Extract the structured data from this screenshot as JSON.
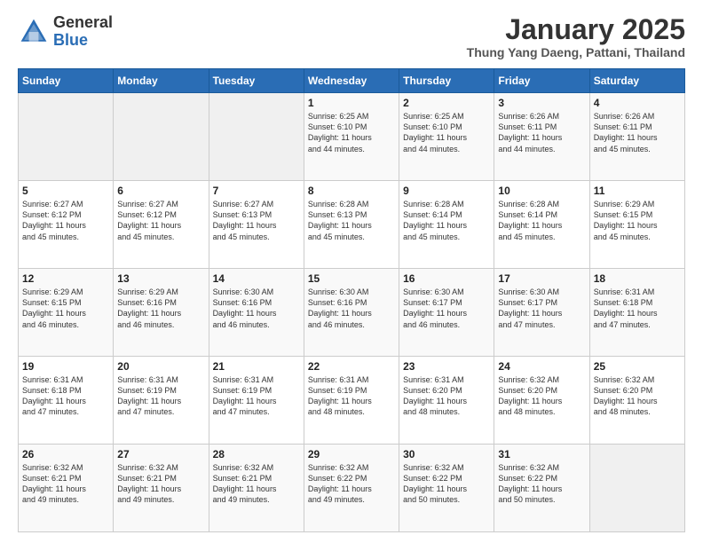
{
  "logo": {
    "general": "General",
    "blue": "Blue"
  },
  "title": "January 2025",
  "subtitle": "Thung Yang Daeng, Pattani, Thailand",
  "days_of_week": [
    "Sunday",
    "Monday",
    "Tuesday",
    "Wednesday",
    "Thursday",
    "Friday",
    "Saturday"
  ],
  "weeks": [
    [
      {
        "day": "",
        "info": ""
      },
      {
        "day": "",
        "info": ""
      },
      {
        "day": "",
        "info": ""
      },
      {
        "day": "1",
        "info": "Sunrise: 6:25 AM\nSunset: 6:10 PM\nDaylight: 11 hours\nand 44 minutes."
      },
      {
        "day": "2",
        "info": "Sunrise: 6:25 AM\nSunset: 6:10 PM\nDaylight: 11 hours\nand 44 minutes."
      },
      {
        "day": "3",
        "info": "Sunrise: 6:26 AM\nSunset: 6:11 PM\nDaylight: 11 hours\nand 44 minutes."
      },
      {
        "day": "4",
        "info": "Sunrise: 6:26 AM\nSunset: 6:11 PM\nDaylight: 11 hours\nand 45 minutes."
      }
    ],
    [
      {
        "day": "5",
        "info": "Sunrise: 6:27 AM\nSunset: 6:12 PM\nDaylight: 11 hours\nand 45 minutes."
      },
      {
        "day": "6",
        "info": "Sunrise: 6:27 AM\nSunset: 6:12 PM\nDaylight: 11 hours\nand 45 minutes."
      },
      {
        "day": "7",
        "info": "Sunrise: 6:27 AM\nSunset: 6:13 PM\nDaylight: 11 hours\nand 45 minutes."
      },
      {
        "day": "8",
        "info": "Sunrise: 6:28 AM\nSunset: 6:13 PM\nDaylight: 11 hours\nand 45 minutes."
      },
      {
        "day": "9",
        "info": "Sunrise: 6:28 AM\nSunset: 6:14 PM\nDaylight: 11 hours\nand 45 minutes."
      },
      {
        "day": "10",
        "info": "Sunrise: 6:28 AM\nSunset: 6:14 PM\nDaylight: 11 hours\nand 45 minutes."
      },
      {
        "day": "11",
        "info": "Sunrise: 6:29 AM\nSunset: 6:15 PM\nDaylight: 11 hours\nand 45 minutes."
      }
    ],
    [
      {
        "day": "12",
        "info": "Sunrise: 6:29 AM\nSunset: 6:15 PM\nDaylight: 11 hours\nand 46 minutes."
      },
      {
        "day": "13",
        "info": "Sunrise: 6:29 AM\nSunset: 6:16 PM\nDaylight: 11 hours\nand 46 minutes."
      },
      {
        "day": "14",
        "info": "Sunrise: 6:30 AM\nSunset: 6:16 PM\nDaylight: 11 hours\nand 46 minutes."
      },
      {
        "day": "15",
        "info": "Sunrise: 6:30 AM\nSunset: 6:16 PM\nDaylight: 11 hours\nand 46 minutes."
      },
      {
        "day": "16",
        "info": "Sunrise: 6:30 AM\nSunset: 6:17 PM\nDaylight: 11 hours\nand 46 minutes."
      },
      {
        "day": "17",
        "info": "Sunrise: 6:30 AM\nSunset: 6:17 PM\nDaylight: 11 hours\nand 47 minutes."
      },
      {
        "day": "18",
        "info": "Sunrise: 6:31 AM\nSunset: 6:18 PM\nDaylight: 11 hours\nand 47 minutes."
      }
    ],
    [
      {
        "day": "19",
        "info": "Sunrise: 6:31 AM\nSunset: 6:18 PM\nDaylight: 11 hours\nand 47 minutes."
      },
      {
        "day": "20",
        "info": "Sunrise: 6:31 AM\nSunset: 6:19 PM\nDaylight: 11 hours\nand 47 minutes."
      },
      {
        "day": "21",
        "info": "Sunrise: 6:31 AM\nSunset: 6:19 PM\nDaylight: 11 hours\nand 47 minutes."
      },
      {
        "day": "22",
        "info": "Sunrise: 6:31 AM\nSunset: 6:19 PM\nDaylight: 11 hours\nand 48 minutes."
      },
      {
        "day": "23",
        "info": "Sunrise: 6:31 AM\nSunset: 6:20 PM\nDaylight: 11 hours\nand 48 minutes."
      },
      {
        "day": "24",
        "info": "Sunrise: 6:32 AM\nSunset: 6:20 PM\nDaylight: 11 hours\nand 48 minutes."
      },
      {
        "day": "25",
        "info": "Sunrise: 6:32 AM\nSunset: 6:20 PM\nDaylight: 11 hours\nand 48 minutes."
      }
    ],
    [
      {
        "day": "26",
        "info": "Sunrise: 6:32 AM\nSunset: 6:21 PM\nDaylight: 11 hours\nand 49 minutes."
      },
      {
        "day": "27",
        "info": "Sunrise: 6:32 AM\nSunset: 6:21 PM\nDaylight: 11 hours\nand 49 minutes."
      },
      {
        "day": "28",
        "info": "Sunrise: 6:32 AM\nSunset: 6:21 PM\nDaylight: 11 hours\nand 49 minutes."
      },
      {
        "day": "29",
        "info": "Sunrise: 6:32 AM\nSunset: 6:22 PM\nDaylight: 11 hours\nand 49 minutes."
      },
      {
        "day": "30",
        "info": "Sunrise: 6:32 AM\nSunset: 6:22 PM\nDaylight: 11 hours\nand 50 minutes."
      },
      {
        "day": "31",
        "info": "Sunrise: 6:32 AM\nSunset: 6:22 PM\nDaylight: 11 hours\nand 50 minutes."
      },
      {
        "day": "",
        "info": ""
      }
    ]
  ]
}
